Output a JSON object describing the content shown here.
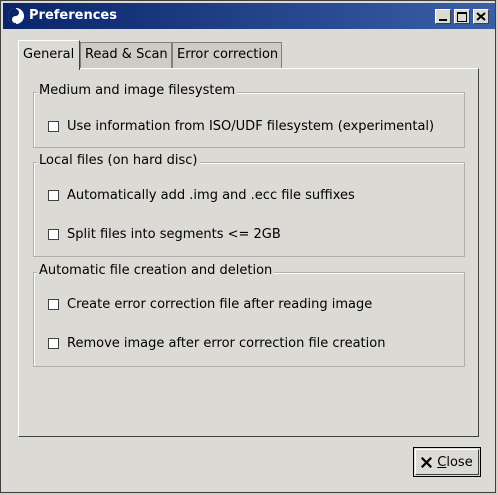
{
  "window": {
    "title": "Preferences",
    "controls": {
      "minimize": "minimize",
      "maximize": "maximize",
      "close": "close"
    }
  },
  "tabs": [
    {
      "label": "General",
      "active": true
    },
    {
      "label": "Read & Scan",
      "active": false
    },
    {
      "label": "Error correction",
      "active": false
    }
  ],
  "general": {
    "medium": {
      "title": "Medium and image filesystem",
      "options": [
        {
          "label": "Use information from ISO/UDF filesystem (experimental)",
          "checked": false
        }
      ]
    },
    "local": {
      "title": "Local files (on hard disc)",
      "options": [
        {
          "label": "Automatically add .img and .ecc file suffixes",
          "checked": false
        },
        {
          "label": "Split files into segments <= 2GB",
          "checked": false
        }
      ]
    },
    "auto": {
      "title": "Automatic file creation and deletion",
      "options": [
        {
          "label": "Create error correction file after reading image",
          "checked": false
        },
        {
          "label": "Remove image after error correction file creation",
          "checked": false
        }
      ]
    }
  },
  "footer": {
    "close_mnemonic": "C",
    "close_rest": "lose",
    "close_icon": "x-icon"
  },
  "colors": {
    "titlebar": "#0a246a",
    "face": "#dcdad5"
  }
}
